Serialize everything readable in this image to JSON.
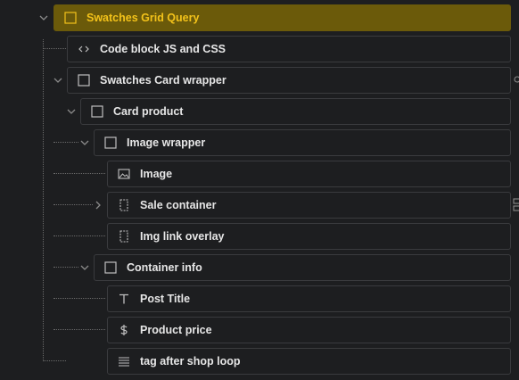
{
  "navigator": {
    "items": [
      {
        "label": "Swatches Grid Query",
        "icon": "square-icon"
      },
      {
        "label": "Code block JS and CSS",
        "icon": "code-icon"
      },
      {
        "label": "Swatches Card wrapper",
        "icon": "square-icon"
      },
      {
        "label": "Card product",
        "icon": "square-icon"
      },
      {
        "label": "Image wrapper",
        "icon": "square-icon"
      },
      {
        "label": "Image",
        "icon": "image-icon"
      },
      {
        "label": "Sale container",
        "icon": "div-block-icon"
      },
      {
        "label": "Img link overlay",
        "icon": "div-block-icon"
      },
      {
        "label": "Container info",
        "icon": "square-icon"
      },
      {
        "label": "Post Title",
        "icon": "text-icon"
      },
      {
        "label": "Product price",
        "icon": "dollar-icon"
      },
      {
        "label": "tag after shop loop",
        "icon": "lines-icon"
      }
    ]
  },
  "colors": {
    "selected_bg": "#6b5a0a",
    "selected_text": "#f3c21a",
    "row_border": "#3a3b3e",
    "background": "#1d1e20"
  }
}
